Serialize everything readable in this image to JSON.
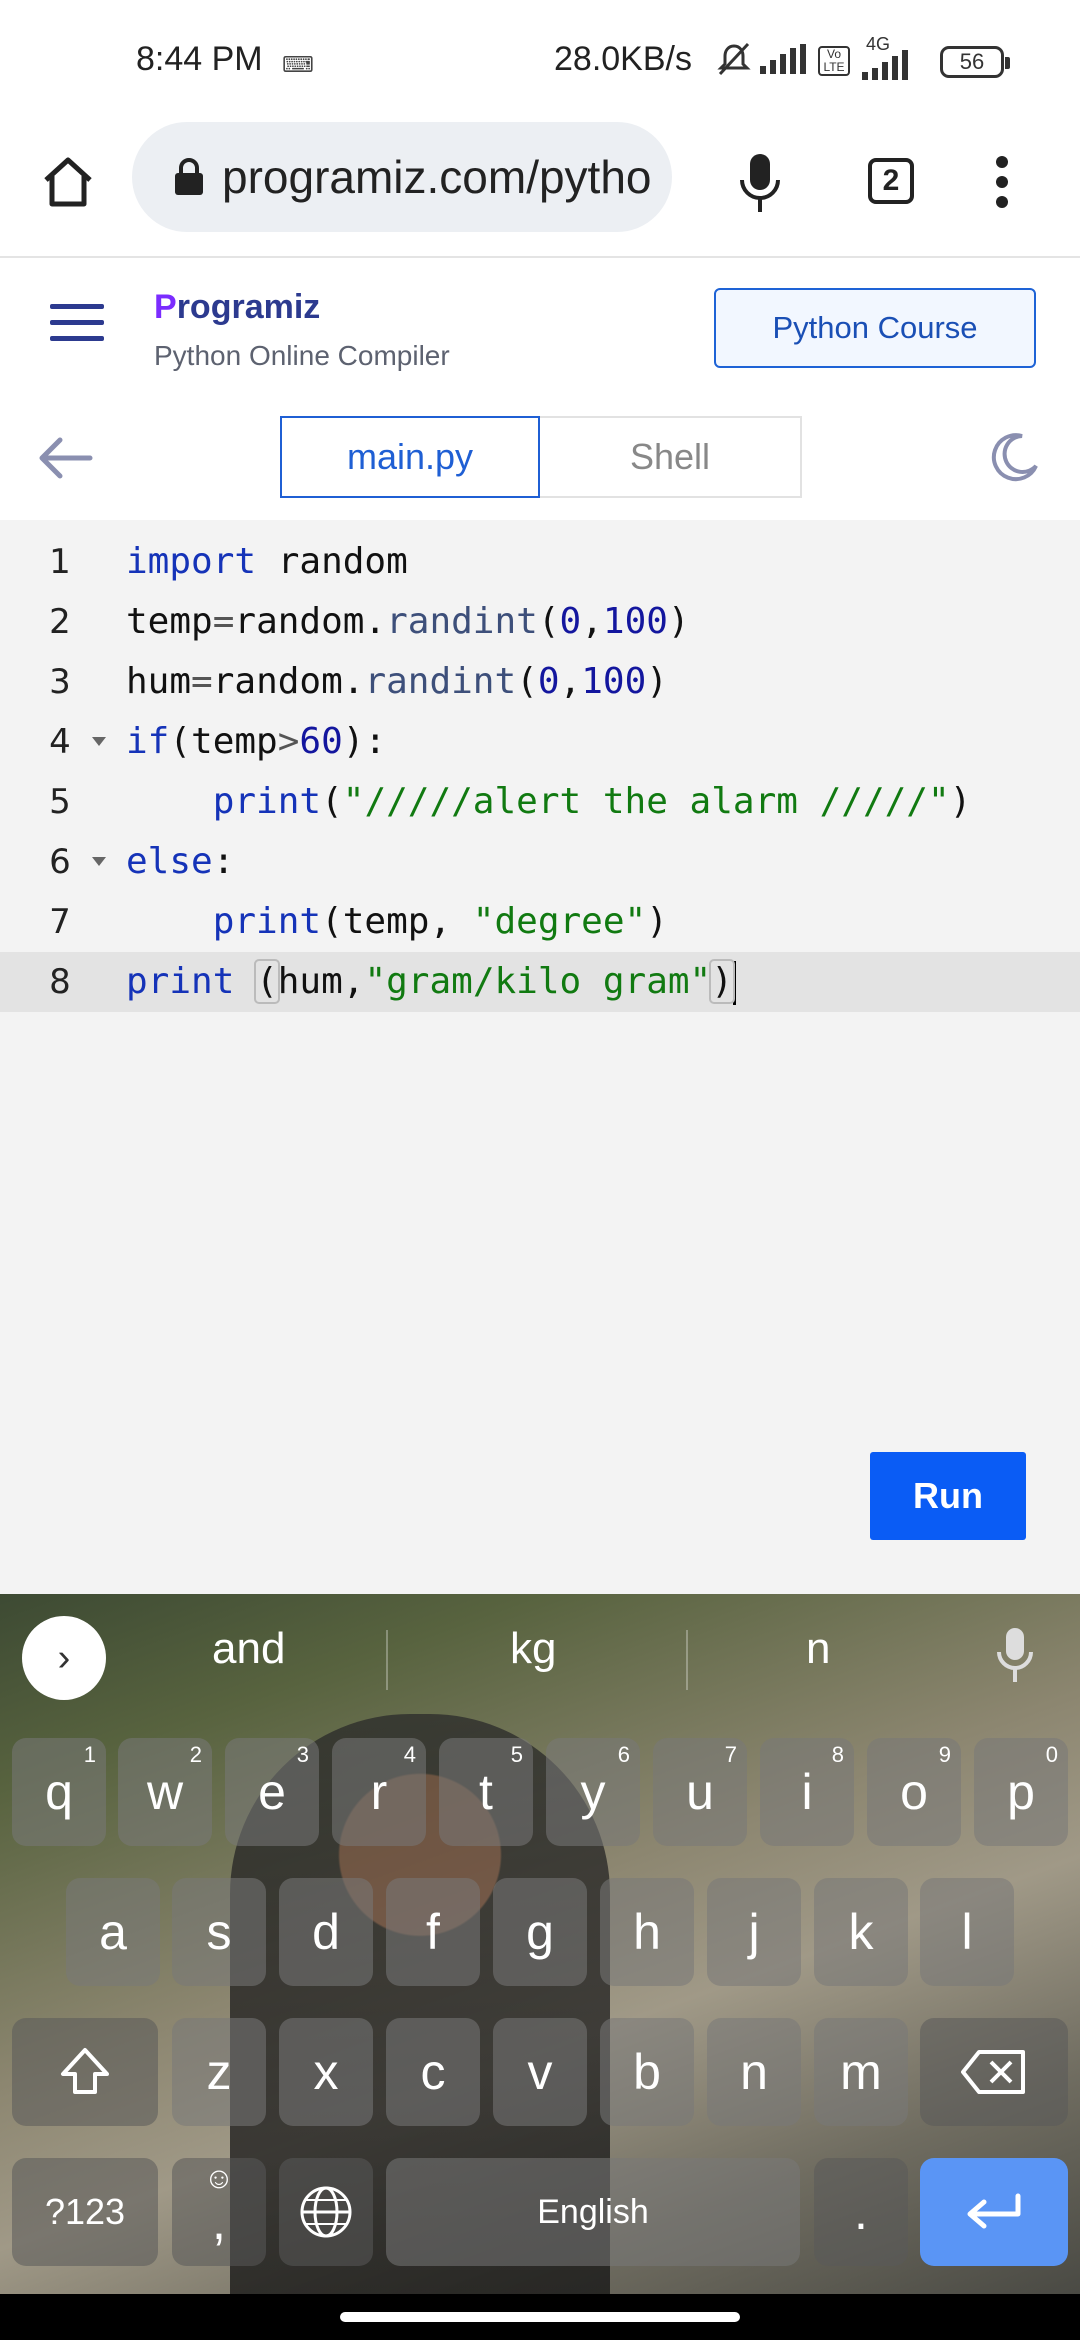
{
  "status": {
    "time": "8:44 PM",
    "kb_icon": "keyboard-icon",
    "speed": "28.0KB/s",
    "battery": "56",
    "network": "4G"
  },
  "browser": {
    "url": "programiz.com/pytho",
    "tab_count": "2"
  },
  "site": {
    "logo": "rogramiz",
    "logo_prefix": "P",
    "subtitle": "Python Online Compiler",
    "course_button": "Python Course"
  },
  "tabs": {
    "active": "main.py",
    "inactive": "Shell"
  },
  "editor": {
    "line_numbers": [
      "1",
      "2",
      "3",
      "4",
      "5",
      "6",
      "7",
      "8"
    ],
    "active_line": 8
  },
  "run_button": "Run",
  "keyboard": {
    "suggestions": [
      "and",
      "kg",
      "n"
    ],
    "row1": [
      "q",
      "w",
      "e",
      "r",
      "t",
      "y",
      "u",
      "i",
      "o",
      "p"
    ],
    "row1_hints": [
      "1",
      "2",
      "3",
      "4",
      "5",
      "6",
      "7",
      "8",
      "9",
      "0"
    ],
    "row2": [
      "a",
      "s",
      "d",
      "f",
      "g",
      "h",
      "j",
      "k",
      "l"
    ],
    "row3": [
      "z",
      "x",
      "c",
      "v",
      "b",
      "n",
      "m"
    ],
    "symbols_key": "?123",
    "comma_key": ",",
    "space_label": "English",
    "period_key": "."
  },
  "colors": {
    "accent": "#1f5fd4",
    "run": "#0a5cf5",
    "enter": "#5a95f5"
  }
}
